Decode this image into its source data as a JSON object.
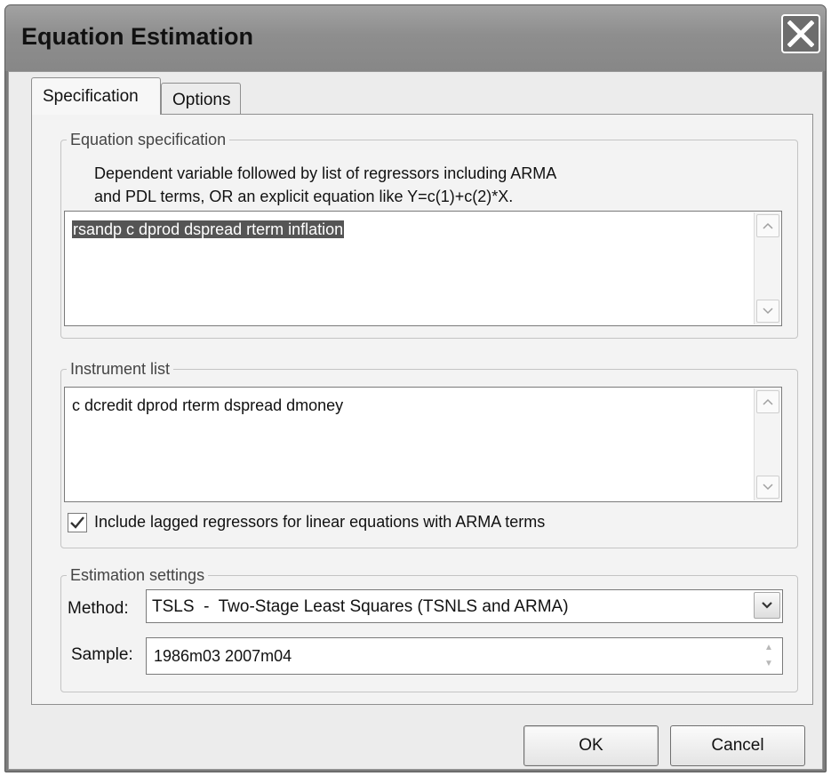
{
  "window": {
    "title": "Equation Estimation"
  },
  "tabs": [
    {
      "label": "Specification",
      "active": true
    },
    {
      "label": "Options",
      "active": false
    }
  ],
  "equation_spec": {
    "legend": "Equation specification",
    "description_line1": "Dependent variable followed by list of regressors including ARMA",
    "description_line2": "and PDL terms, OR an explicit equation like Y=c(1)+c(2)*X.",
    "value": "rsandp c dprod dspread rterm inflation"
  },
  "instrument_list": {
    "legend": "Instrument list",
    "value": "c dcredit dprod rterm dspread dmoney",
    "checkbox_label": "Include lagged regressors for linear equations with ARMA terms",
    "checkbox_checked": true
  },
  "estimation_settings": {
    "legend": "Estimation settings",
    "method_label": "Method:",
    "method_value": "TSLS  -  Two-Stage Least Squares (TSNLS and ARMA)",
    "sample_label": "Sample:",
    "sample_value": "1986m03 2007m04"
  },
  "buttons": {
    "ok": "OK",
    "cancel": "Cancel"
  },
  "icons": {
    "close": "close-icon",
    "scroll_up": "scroll-up-icon",
    "scroll_down": "scroll-down-icon",
    "dropdown": "chevron-down-icon",
    "check": "checkmark-icon"
  }
}
